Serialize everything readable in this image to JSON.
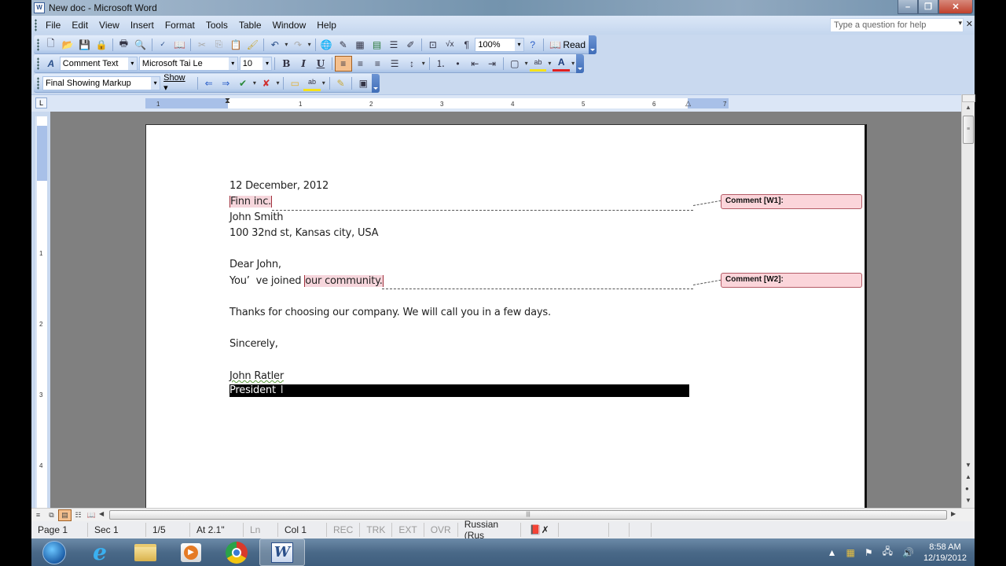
{
  "window": {
    "title": "New doc - Microsoft Word",
    "controls": {
      "minimize": "–",
      "maximize": "❐",
      "close": "✕"
    }
  },
  "menubar": {
    "items": [
      "File",
      "Edit",
      "View",
      "Insert",
      "Format",
      "Tools",
      "Table",
      "Window",
      "Help"
    ],
    "help_placeholder": "Type a question for help"
  },
  "standard_toolbar": {
    "icons": [
      "new-icon",
      "open-icon",
      "save-icon",
      "permission-icon",
      "print-icon",
      "print-preview-icon",
      "spelling-icon",
      "research-icon",
      "cut-icon",
      "copy-icon",
      "paste-icon",
      "format-painter-icon",
      "undo-icon",
      "redo-icon",
      "hyperlink-icon",
      "tables-borders-icon",
      "insert-table-icon",
      "insert-excel-icon",
      "columns-icon",
      "drawing-icon",
      "document-map-icon",
      "equation-icon",
      "show-hide-icon",
      "help-icon",
      "read-icon"
    ],
    "zoom": "100%",
    "read_label": "Read"
  },
  "formatting_toolbar": {
    "style": "Comment Text",
    "font": "Microsoft Tai Le",
    "size": "10",
    "bold": "B",
    "italic": "I",
    "underline": "U",
    "alignment_active": "align-left"
  },
  "reviewing_toolbar": {
    "display_mode": "Final Showing Markup",
    "show_label": "Show"
  },
  "ruler": {
    "numbers": [
      "1",
      "1",
      "2",
      "3",
      "4",
      "5",
      "6",
      "7"
    ],
    "vertical_numbers": [
      "1",
      "2",
      "3",
      "4"
    ]
  },
  "document": {
    "lines": [
      "12 December, 2012",
      "Finn inc.",
      "John Smith",
      "100 32nd st, Kansas city, USA",
      "",
      "Dear John,",
      "You’  ve joined ",
      "our community.",
      "",
      "Thanks for choosing our company. We will call you in a few days.",
      "",
      "Sincerely,",
      "",
      "John Ratler",
      "President "
    ],
    "comments": [
      {
        "label": "Comment [W1]:",
        "anchor": "Finn inc."
      },
      {
        "label": "Comment [W2]:",
        "anchor": "our community."
      }
    ]
  },
  "statusbar": {
    "page": "Page  1",
    "sec": "Sec  1",
    "pages": "1/5",
    "at": "At  2.1\"",
    "ln": "Ln",
    "col": "Col  1",
    "rec": "REC",
    "trk": "TRK",
    "ext": "EXT",
    "ovr": "OVR",
    "language": "Russian (Rus"
  },
  "taskbar": {
    "apps": [
      "start-orb",
      "internet-explorer",
      "windows-explorer",
      "media-player",
      "chrome",
      "microsoft-word"
    ],
    "active_app": "microsoft-word",
    "time": "8:58 AM",
    "date": "12/19/2012"
  }
}
